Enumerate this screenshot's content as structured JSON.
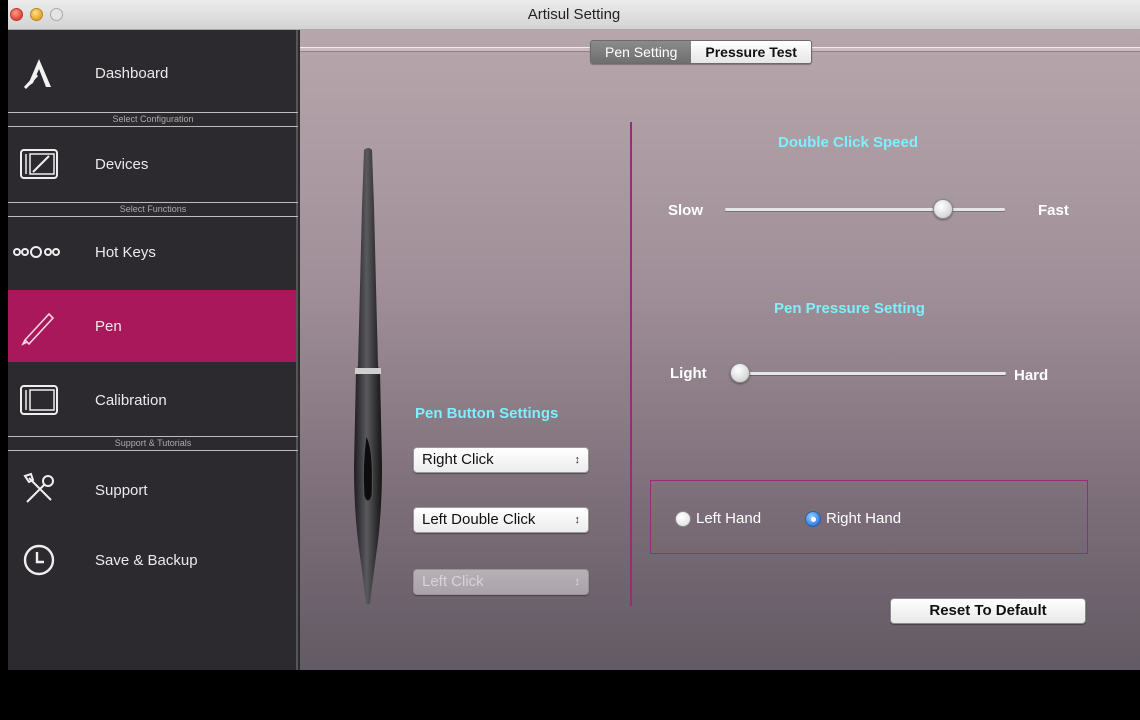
{
  "window": {
    "title": "Artisul Setting"
  },
  "sidebar": {
    "items": [
      {
        "label": "Dashboard",
        "icon": "artisul-logo-icon"
      },
      {
        "label": "Devices",
        "icon": "tablet-icon"
      },
      {
        "label": "Hot Keys",
        "icon": "hotkeys-dots-icon"
      },
      {
        "label": "Pen",
        "icon": "pen-icon",
        "active": true
      },
      {
        "label": "Calibration",
        "icon": "calibration-tablet-icon"
      },
      {
        "label": "Support",
        "icon": "tools-icon"
      },
      {
        "label": "Save & Backup",
        "icon": "clock-icon"
      }
    ],
    "sections": [
      "Select Configuration",
      "Select Functions",
      "Support & Tutorials"
    ]
  },
  "tabs": {
    "pen_setting": "Pen Setting",
    "pressure_test": "Pressure Test",
    "active": "Pen Setting"
  },
  "pen_buttons": {
    "title": "Pen Button Settings",
    "select1": "Right Click",
    "select2": "Left Double Click",
    "select3": "Left Click",
    "select3_disabled": true
  },
  "double_click": {
    "title": "Double Click Speed",
    "min_label": "Slow",
    "max_label": "Fast",
    "value_fraction": 0.78
  },
  "pressure": {
    "title": "Pen Pressure Setting",
    "min_label": "Light",
    "max_label": "Hard",
    "value_fraction": 0.0
  },
  "hand": {
    "left_label": "Left Hand",
    "right_label": "Right Hand",
    "selected": "Right Hand"
  },
  "reset_label": "Reset To Default",
  "colors": {
    "accent_active": "#a8185a",
    "heading_cyan": "#7cf0ff",
    "divider_purple": "#9a2a7c"
  }
}
